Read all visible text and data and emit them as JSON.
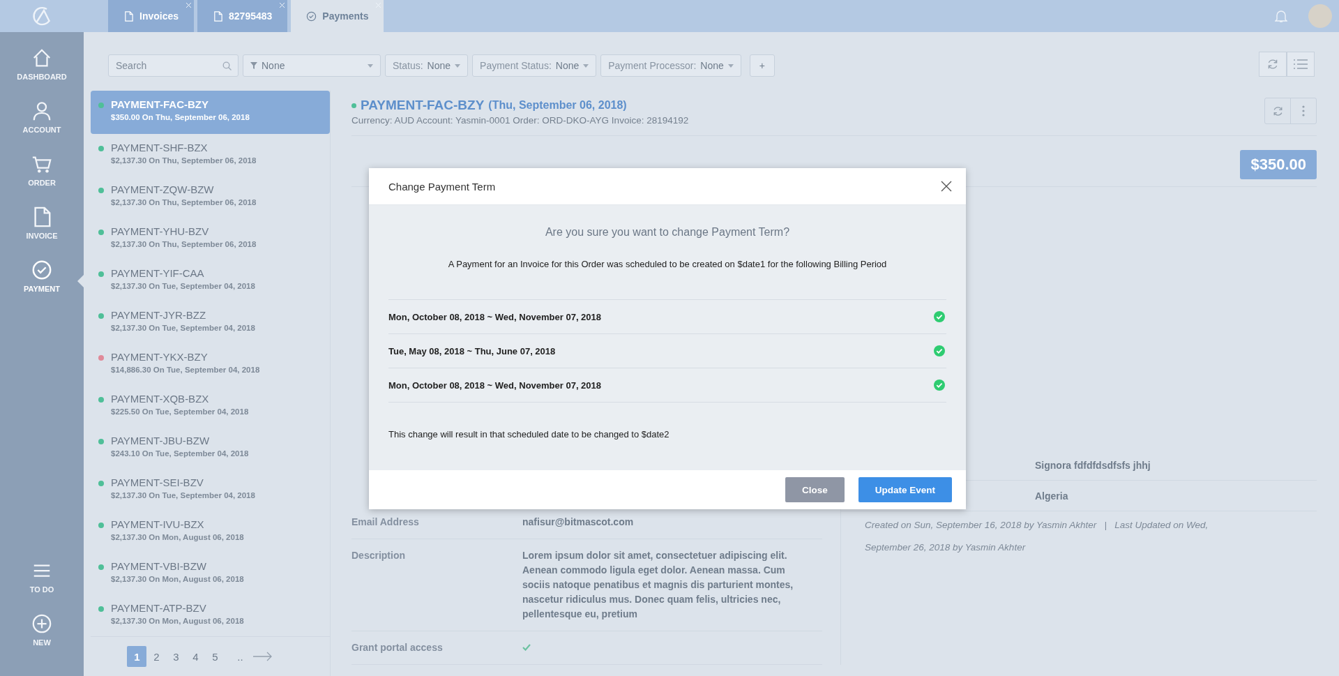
{
  "top_bar": {
    "tabs": [
      {
        "label": "Invoices",
        "selected": false
      },
      {
        "label": "82795483",
        "selected": false
      },
      {
        "label": "Payments",
        "selected": true
      }
    ]
  },
  "nav": {
    "items": [
      {
        "label": "DASHBOARD",
        "selected": false
      },
      {
        "label": "ACCOUNT",
        "selected": false
      },
      {
        "label": "ORDER",
        "selected": false
      },
      {
        "label": "INVOICE",
        "selected": false
      },
      {
        "label": "PAYMENT",
        "selected": true
      }
    ],
    "bottom_items": [
      {
        "label": "TO DO"
      },
      {
        "label": "NEW"
      }
    ]
  },
  "filters": {
    "search": {
      "placeholder": "Search"
    },
    "dropdowns": [
      {
        "kind": "filter",
        "value": "None"
      },
      {
        "kind": "labeled",
        "label": "Status:",
        "value": "None"
      },
      {
        "kind": "labeled",
        "label": "Payment Status:",
        "value": "None"
      },
      {
        "kind": "labeled",
        "label": "Payment Processor:",
        "value": "None"
      }
    ],
    "add": "+"
  },
  "payments": {
    "items": [
      {
        "title": "PAYMENT-FAC-BZY",
        "subtitle": "$350.00 On Thu, September 06, 2018",
        "color": "#4fbf98",
        "selected": true
      },
      {
        "title": "PAYMENT-SHF-BZX",
        "subtitle": "$2,137.30 On Thu, September 06, 2018",
        "color": "#4fbf98",
        "selected": false
      },
      {
        "title": "PAYMENT-ZQW-BZW",
        "subtitle": "$2,137.30 On Thu, September 06, 2018",
        "color": "#4fbf98",
        "selected": false
      },
      {
        "title": "PAYMENT-YHU-BZV",
        "subtitle": "$2,137.30 On Thu, September 06, 2018",
        "color": "#4fbf98",
        "selected": false
      },
      {
        "title": "PAYMENT-YIF-CAA",
        "subtitle": "$2,137.30 On Tue, September 04, 2018",
        "color": "#4fbf98",
        "selected": false
      },
      {
        "title": "PAYMENT-JYR-BZZ",
        "subtitle": "$2,137.30 On Tue, September 04, 2018",
        "color": "#4fbf98",
        "selected": false
      },
      {
        "title": "PAYMENT-YKX-BZY",
        "subtitle": "$14,886.30 On Tue, September 04, 2018",
        "color": "#e08a99",
        "selected": false
      },
      {
        "title": "PAYMENT-XQB-BZX",
        "subtitle": "$225.50 On Tue, September 04, 2018",
        "color": "#4fbf98",
        "selected": false
      },
      {
        "title": "PAYMENT-JBU-BZW",
        "subtitle": "$243.10 On Tue, September 04, 2018",
        "color": "#4fbf98",
        "selected": false
      },
      {
        "title": "PAYMENT-SEI-BZV",
        "subtitle": "$2,137.30 On Tue, September 04, 2018",
        "color": "#4fbf98",
        "selected": false
      },
      {
        "title": "PAYMENT-IVU-BZX",
        "subtitle": "$2,137.30 On Mon, August 06, 2018",
        "color": "#4fbf98",
        "selected": false
      },
      {
        "title": "PAYMENT-VBI-BZW",
        "subtitle": "$2,137.30 On Mon, August 06, 2018",
        "color": "#4fbf98",
        "selected": false
      },
      {
        "title": "PAYMENT-ATP-BZV",
        "subtitle": "$2,137.30 On Mon, August 06, 2018",
        "color": "#4fbf98",
        "selected": false
      }
    ],
    "pagination": {
      "pages": [
        {
          "label": "1",
          "selected": true
        },
        {
          "label": "2",
          "selected": false
        },
        {
          "label": "3",
          "selected": false
        },
        {
          "label": "4",
          "selected": false
        },
        {
          "label": "5",
          "selected": false
        }
      ],
      "ellipsis": ".."
    }
  },
  "detail": {
    "title": "PAYMENT-FAC-BZY",
    "date": "(Thu, September 06, 2018)",
    "meta": "Currency: AUD Account: Yasmin-0001 Order: ORD-DKO-AYG Invoice: 28194192",
    "amount": "$350.00",
    "fields_left": [
      {
        "kind": "text",
        "label": "Email Address",
        "value": "nafisur@bitmascot.com"
      },
      {
        "kind": "text",
        "label": "Description",
        "value": "Lorem ipsum dolor sit amet, consectetuer adipiscing elit. Aenean commodo ligula eget dolor. Aenean massa. Cum sociis natoque penatibus et magnis dis parturient montes, nascetur ridiculus mus. Donec quam felis, ultricies nec, pellentesque eu, pretium"
      },
      {
        "kind": "check",
        "label": "Grant portal access",
        "checked": true
      }
    ],
    "fields_right": [
      {
        "value": "Signora fdfdfdsdfsfs jhhj"
      },
      {
        "value": "Algeria"
      }
    ],
    "audit": "Created on Sun, September 16, 2018 by Yasmin Akhter   |   Last Updated on Wed, September 26, 2018 by Yasmin Akhter"
  },
  "modal": {
    "title": "Change Payment Term",
    "question": "Are you sure you want to change Payment Term?",
    "message": "A Payment for an Invoice for this Order was scheduled to be created on $date1 for the following Billing Period",
    "periods": [
      {
        "label": "Mon, October 08, 2018 ~ Wed, November 07, 2018",
        "checked": true
      },
      {
        "label": "Tue, May 08, 2018 ~ Thu, June 07, 2018",
        "checked": true
      },
      {
        "label": "Mon, October 08, 2018 ~ Wed, November 07, 2018",
        "checked": true
      }
    ],
    "note": "This change will result in that scheduled date to be changed to $date2",
    "buttons": [
      {
        "label": "Close",
        "kind": "secondary"
      },
      {
        "label": "Update Event",
        "kind": "primary"
      }
    ]
  }
}
